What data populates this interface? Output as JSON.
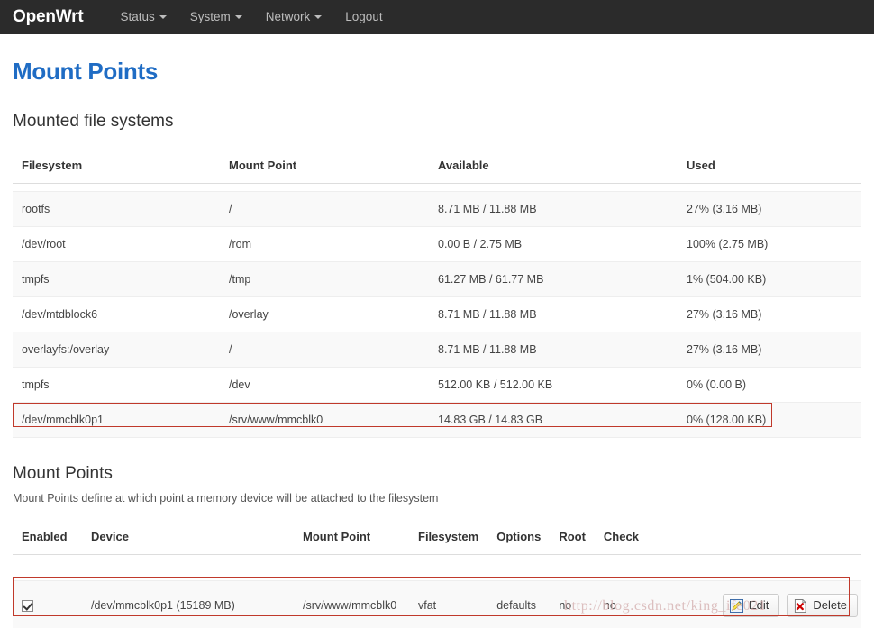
{
  "navbar": {
    "brand": "OpenWrt",
    "items": [
      {
        "label": "Status",
        "has_caret": true
      },
      {
        "label": "System",
        "has_caret": true
      },
      {
        "label": "Network",
        "has_caret": true
      },
      {
        "label": "Logout",
        "has_caret": false
      }
    ]
  },
  "page": {
    "title": "Mount Points"
  },
  "mounted_filesystems": {
    "legend": "Mounted file systems",
    "columns": [
      "Filesystem",
      "Mount Point",
      "Available",
      "Used"
    ],
    "rows": [
      {
        "filesystem": "rootfs",
        "mount_point": "/",
        "available": "8.71 MB / 11.88 MB",
        "used": "27% (3.16 MB)"
      },
      {
        "filesystem": "/dev/root",
        "mount_point": "/rom",
        "available": "0.00 B / 2.75 MB",
        "used": "100% (2.75 MB)"
      },
      {
        "filesystem": "tmpfs",
        "mount_point": "/tmp",
        "available": "61.27 MB / 61.77 MB",
        "used": "1% (504.00 KB)"
      },
      {
        "filesystem": "/dev/mtdblock6",
        "mount_point": "/overlay",
        "available": "8.71 MB / 11.88 MB",
        "used": "27% (3.16 MB)"
      },
      {
        "filesystem": "overlayfs:/overlay",
        "mount_point": "/",
        "available": "8.71 MB / 11.88 MB",
        "used": "27% (3.16 MB)"
      },
      {
        "filesystem": "tmpfs",
        "mount_point": "/dev",
        "available": "512.00 KB / 512.00 KB",
        "used": "0% (0.00 B)"
      },
      {
        "filesystem": "/dev/mmcblk0p1",
        "mount_point": "/srv/www/mmcblk0",
        "available": "14.83 GB / 14.83 GB",
        "used": "0% (128.00 KB)"
      }
    ]
  },
  "mount_points": {
    "legend": "Mount Points",
    "description": "Mount Points define at which point a memory device will be attached to the filesystem",
    "columns": [
      "Enabled",
      "Device",
      "Mount Point",
      "Filesystem",
      "Options",
      "Root",
      "Check"
    ],
    "rows": [
      {
        "enabled": true,
        "device": "/dev/mmcblk0p1 (15189 MB)",
        "mount_point": "/srv/www/mmcblk0",
        "filesystem": "vfat",
        "options": "defaults",
        "root": "no",
        "check": "no",
        "edit_label": "Edit",
        "delete_label": "Delete"
      }
    ]
  },
  "watermark": "http://blog.csdn.net/king_ife021",
  "colors": {
    "navbar_bg": "#2b2b2b",
    "title_blue": "#1f6cc4",
    "annotation_red": "#c0392b",
    "row_stripe": "#f9f9f9"
  }
}
